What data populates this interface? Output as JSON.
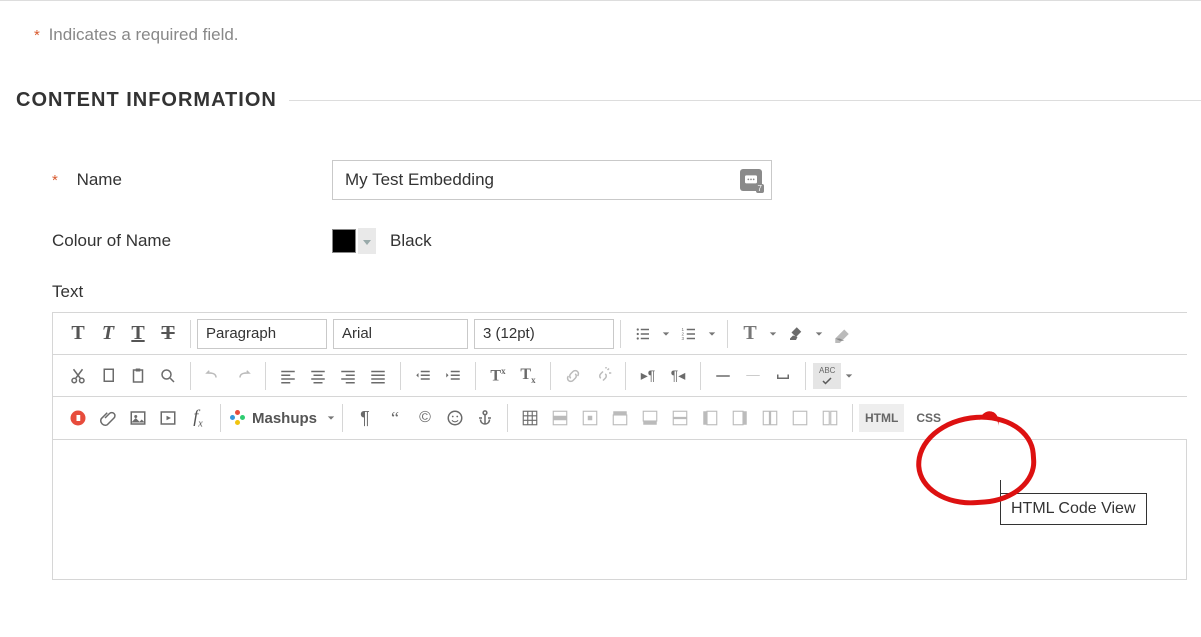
{
  "required_note": "Indicates a required field.",
  "section_title": "CONTENT INFORMATION",
  "fields": {
    "name": {
      "label": "Name",
      "value": "My Test Embedding"
    },
    "colour": {
      "label": "Colour of Name",
      "value_label": "Black",
      "swatch": "#000000"
    },
    "text": {
      "label": "Text"
    }
  },
  "toolbar": {
    "format": "Paragraph",
    "font": "Arial",
    "size": "3 (12pt)",
    "mashups": "Mashups",
    "abc_label": "ABC",
    "html_label": "HTML",
    "css_label": "CSS"
  },
  "tooltip": "HTML Code View"
}
